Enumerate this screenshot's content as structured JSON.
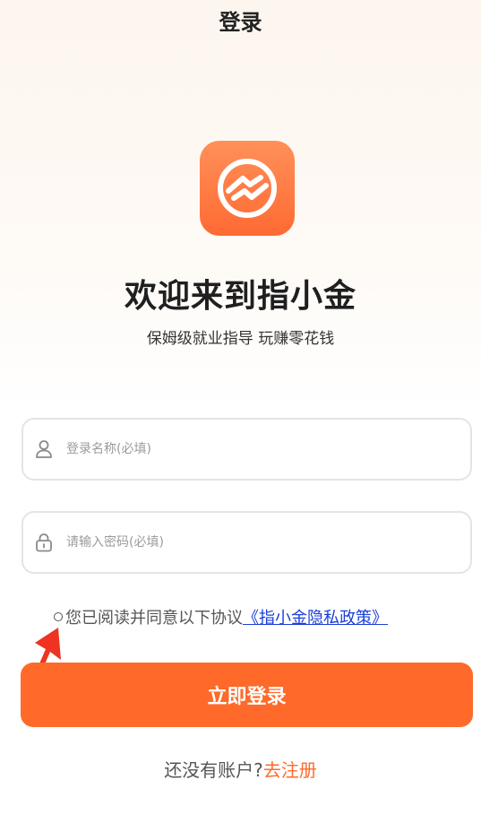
{
  "header": {
    "title": "登录"
  },
  "brand": {
    "welcome": "欢迎来到指小金",
    "slogan": "保姆级就业指导 玩赚零花钱",
    "accent_color": "#ff6a2a"
  },
  "form": {
    "username": {
      "placeholder": "登录名称(必填)",
      "value": "",
      "icon": "user-icon"
    },
    "password": {
      "placeholder": "请输入密码(必填)",
      "value": "",
      "icon": "lock-icon"
    }
  },
  "agreement": {
    "text": "您已阅读并同意以下协议",
    "link_text": "《指小金隐私政策》",
    "checked": false
  },
  "actions": {
    "login_label": "立即登录"
  },
  "register": {
    "prompt": "还没有账户?",
    "link_text": "去注册"
  }
}
